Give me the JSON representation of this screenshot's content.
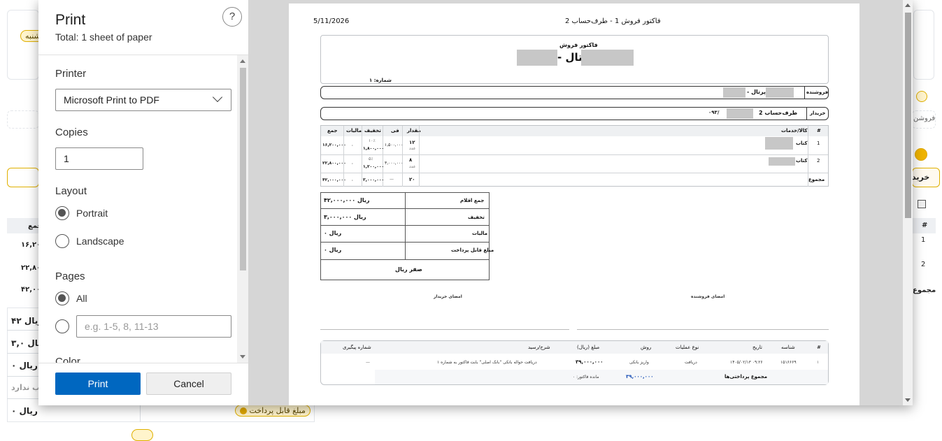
{
  "background": {
    "badge_top": "شنبه",
    "right_label": "فروشن",
    "right_button": "خرید",
    "table_header_total": "جمع",
    "table_header_num": "#",
    "rows": [
      {
        "total": "۱۶,۲۰۰,...",
        "num": "1"
      },
      {
        "total": "۲۲,۸۰۰,...",
        "num": "2"
      },
      {
        "total": "۴۲,۰۰۰,..",
        "num": "مجموع"
      }
    ],
    "summary": [
      {
        "value": "۴۲ ریال"
      },
      {
        "value": "۳,۰ ریال"
      },
      {
        "value": "۰ ریال"
      },
      {
        "value": "اب ندارد"
      },
      {
        "value": "۰ ریال"
      }
    ],
    "payable_badge": "مبلغ قابل پرداخت"
  },
  "dialog": {
    "title": "Print",
    "subtitle": "Total: 1 sheet of paper",
    "help": "?",
    "printer_label": "Printer",
    "printer_value": "Microsoft Print to PDF",
    "copies_label": "Copies",
    "copies_value": "1",
    "layout_label": "Layout",
    "layout_portrait": "Portrait",
    "layout_landscape": "Landscape",
    "pages_label": "Pages",
    "pages_all": "All",
    "pages_placeholder": "e.g. 1-5, 8, 11-13",
    "color_label": "Color",
    "print_button": "Print",
    "cancel_button": "Cancel"
  },
  "invoice": {
    "date": "5/11/2026",
    "header_title": "فاکتور فروش 1 - طرف‌حساب 2",
    "doc_type": "فاکتور فروش",
    "company": "- پرتال",
    "number_label": "شماره: ۱",
    "seller_label": "فروشنده",
    "seller_value": "- پرتال",
    "buyer_label": "خریدار",
    "buyer_value": "طرف‌حساب 2",
    "buyer_phone": "۰۹۳/",
    "items_headers": {
      "num": "#",
      "goods": "کالا/خدمات",
      "qty": "مقدار",
      "price": "فی",
      "discount": "تخفیف",
      "tax": "مالیات",
      "total": "جمع"
    },
    "items": [
      {
        "num": "1",
        "goods": "کتاب",
        "qty": "۱۲",
        "unit": "عدد",
        "price": "۱,۵۰۰,۰۰۰",
        "discount_pct": "۱۰٪",
        "discount": "۱,۸۰۰,۰۰۰",
        "tax": "۰",
        "total": "۱۶,۲۰۰,۰۰۰"
      },
      {
        "num": "2",
        "goods": "کتاب",
        "qty": "۸",
        "unit": "عدد",
        "price": "۳,۰۰۰,۰۰۰",
        "discount_pct": "۵٪",
        "discount": "۱,۲۰۰,۰۰۰",
        "tax": "۰",
        "total": "۲۲,۸۰۰,۰۰۰"
      }
    ],
    "items_total": {
      "label": "مجموع",
      "qty": "۲۰",
      "price": "—",
      "discount": "۳,۰۰۰,۰۰۰",
      "tax": "۰",
      "total": "۴۲,۰۰۰,۰۰۰"
    },
    "summary": [
      {
        "label": "جمع اقلام",
        "value": "۴۲,۰۰۰,۰۰۰ ریال"
      },
      {
        "label": "تخفیف",
        "value": "۳,۰۰۰,۰۰۰ ریال"
      },
      {
        "label": "مالیات",
        "value": "۰ ریال"
      },
      {
        "label": "مبلغ قابل پرداخت",
        "value": "۰ ریال"
      }
    ],
    "amount_words": "صفر ریال",
    "sign_buyer": "امضای خریدار",
    "sign_seller": "امضای فروشنده",
    "payments_headers": {
      "num": "#",
      "id": "شناسه",
      "date": "تاریخ",
      "op": "نوع عملیات",
      "method": "روش",
      "amount": "مبلغ (ریال)",
      "desc": "شرح/رسید",
      "tracking": "شماره پیگیری"
    },
    "payments": [
      {
        "num": "۱",
        "id": "۱۵۱۶۶۶۹",
        "date": "۱۴۰۵/۰۲/۱۳ ۰۹:۲۶",
        "op": "دریافت",
        "method": "واریز بانکی",
        "amount": "۳۹,۰۰۰,۰۰۰",
        "desc": "دریافت حواله بانکی \"بانک اصلی\" بابت فاکتور به شماره ۱",
        "tracking": "—"
      }
    ],
    "payments_total_label": "مجموع پرداختی‌ها",
    "payments_total": "۳۹,۰۰۰,۰۰۰",
    "remaining_label": "مانده فاکتور: ۰"
  }
}
